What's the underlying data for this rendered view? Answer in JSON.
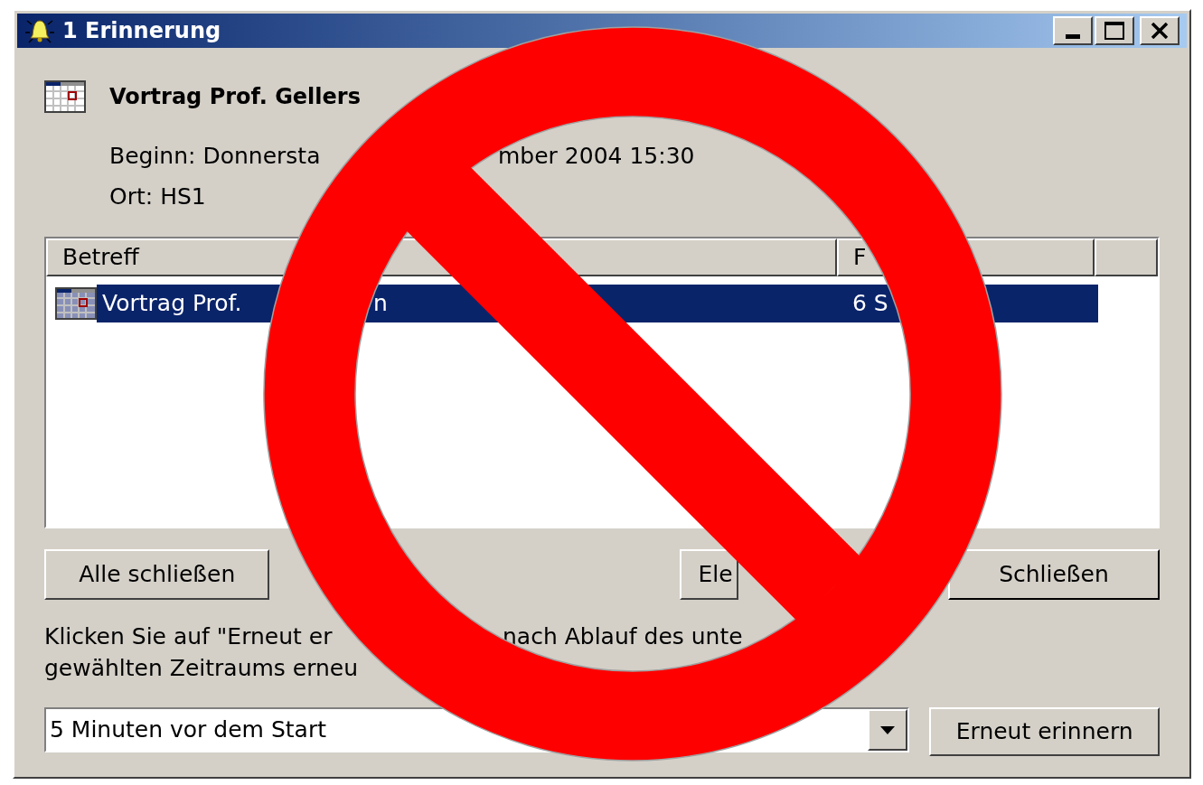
{
  "window": {
    "title": "1 Erinnerung"
  },
  "reminder": {
    "subject": "Vortrag Prof. Gellers",
    "start_parts": [
      "Beginn: Donnersta",
      "mber 2004 15:30"
    ],
    "location": "Ort: HS1"
  },
  "list": {
    "columns": [
      "Betreff",
      "F"
    ],
    "rows": [
      {
        "subject_parts": [
          "Vortrag Prof.",
          "n"
        ],
        "due": "6 S",
        "selected": true
      }
    ]
  },
  "buttons": [
    {
      "label": "Alle schließen",
      "default": false
    },
    {
      "label": "Ele",
      "default": false
    },
    {
      "label": "Schließen",
      "default": true
    }
  ],
  "note": {
    "lines": [
      [
        "Klicken Sie auf \"Erneut er",
        "nach Ablauf des unte"
      ],
      [
        "gewählten Zeitraums erneu"
      ]
    ]
  },
  "snooze": {
    "value": "5 Minuten vor dem Start",
    "button": "Erneut erinnern"
  },
  "overlay": {
    "kind": "prohibition-sign"
  }
}
